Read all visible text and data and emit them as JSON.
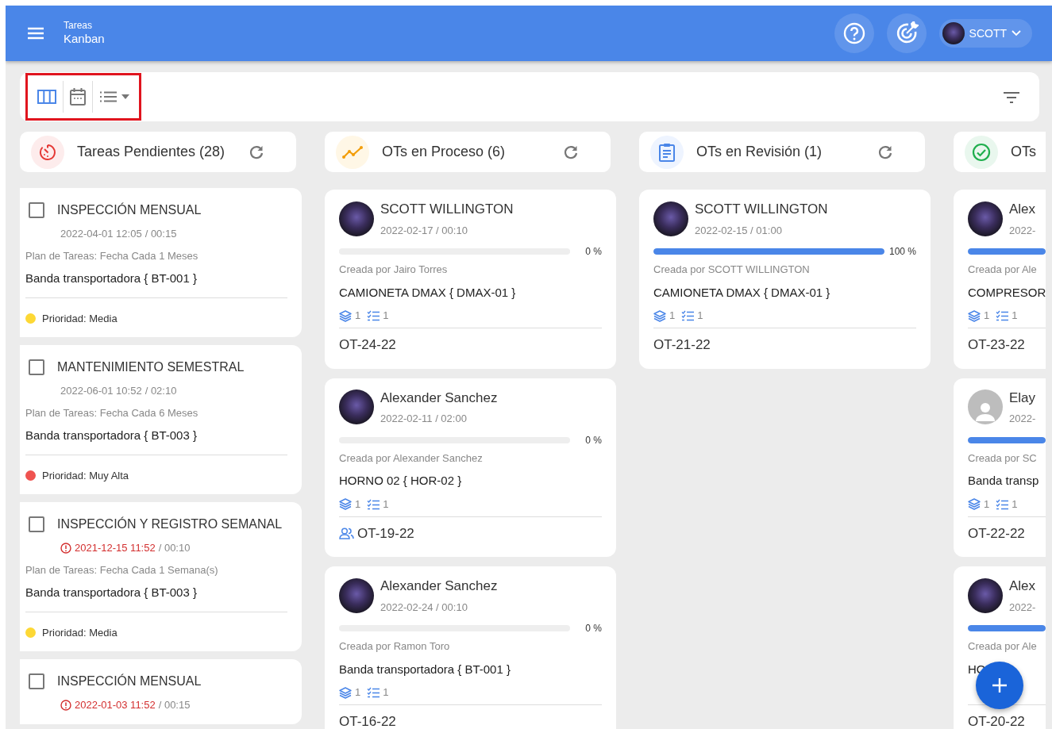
{
  "header": {
    "section": "Tareas",
    "title": "Kanban",
    "user": {
      "name": "SCOTT"
    }
  },
  "toolbar": {
    "highlighted": true,
    "views": [
      {
        "kind": "kanban",
        "selected": true
      },
      {
        "kind": "calendar",
        "selected": false
      },
      {
        "kind": "list",
        "selected": false
      }
    ]
  },
  "columns": [
    {
      "kind": "pending",
      "title": "Tareas Pendientes (28)",
      "cards": [
        {
          "checked": false,
          "title": "INSPECCIÓN MENSUAL",
          "date": "2022-04-01 12:05",
          "duration": "/ 00:15",
          "overdue": false,
          "plan": "Plan de Tareas: Fecha Cada 1 Meses",
          "asset": "Banda transportadora { BT-001 }",
          "priority": "Prioridad: Media",
          "color": "#fdd835"
        },
        {
          "checked": false,
          "title": "MANTENIMIENTO SEMESTRAL",
          "date": "2022-06-01 10:52",
          "duration": "/ 02:10",
          "overdue": false,
          "plan": "Plan de Tareas: Fecha Cada 6 Meses",
          "asset": "Banda transportadora { BT-003 }",
          "priority": "Prioridad: Muy Alta",
          "color": "#ef5350"
        },
        {
          "checked": false,
          "title": "INSPECCIÓN Y REGISTRO SEMANAL",
          "date": "2021-12-15 11:52",
          "duration": "/ 00:10",
          "overdue": true,
          "plan": "Plan de Tareas: Fecha Cada 1 Semana(s)",
          "asset": "Banda transportadora { BT-003 }",
          "priority": "Prioridad: Media",
          "color": "#fdd835"
        },
        {
          "checked": false,
          "title": "INSPECCIÓN MENSUAL",
          "date": "2022-01-03 11:52",
          "duration": "/ 00:15",
          "overdue": true
        }
      ]
    },
    {
      "kind": "process",
      "title": "OTs en Proceso (6)",
      "cards": [
        {
          "kind": "photo",
          "name": "SCOTT WILLINGTON",
          "date": "2022-02-17 / 00:10",
          "level": 0,
          "reading": "0 %",
          "creator": "Creada por Jairo Torres",
          "asset": "CAMIONETA DMAX { DMAX-01 }",
          "stack_count": "1",
          "task_count": "1",
          "team": false,
          "id": "OT-24-22"
        },
        {
          "kind": "photo",
          "name": "Alexander Sanchez",
          "date": "2022-02-11 / 02:00",
          "level": 0,
          "reading": "0 %",
          "creator": "Creada por Alexander Sanchez",
          "asset": "HORNO 02 { HOR-02 }",
          "stack_count": "1",
          "task_count": "1",
          "team": true,
          "id": "OT-19-22"
        },
        {
          "kind": "photo",
          "name": "Alexander Sanchez",
          "date": "2022-02-24 / 00:10",
          "level": 0,
          "reading": "0 %",
          "creator": "Creada por Ramon Toro",
          "asset": "Banda transportadora { BT-001 }",
          "stack_count": "1",
          "task_count": "1",
          "team": false,
          "id": "OT-16-22"
        }
      ]
    },
    {
      "kind": "review",
      "title": "OTs en Revisión (1)",
      "cards": [
        {
          "kind": "photo",
          "name": "SCOTT WILLINGTON",
          "date": "2022-02-15 / 01:00",
          "level": 1,
          "reading": "100 %",
          "creator": "Creada por SCOTT WILLINGTON",
          "asset": "CAMIONETA DMAX { DMAX-01 }",
          "stack_count": "1",
          "task_count": "1",
          "team": false,
          "id": "OT-21-22"
        }
      ]
    },
    {
      "kind": "done",
      "title": "OTs",
      "cards": [
        {
          "kind": "photo",
          "name": "Alex",
          "date": "2022-",
          "level": 1,
          "creator": "Creada por Ale",
          "asset": "COMPRESOR",
          "stack_count": "1",
          "task_count": "1",
          "team": false,
          "id": "OT-23-22"
        },
        {
          "kind": "placeholder",
          "name": "Elay",
          "date": "2022-",
          "level": 1,
          "creator": "Creada por SC",
          "asset": "Banda transp",
          "stack_count": "1",
          "task_count": "1",
          "team": false,
          "id": "OT-22-22"
        },
        {
          "kind": "photo",
          "name": "Alex",
          "date": "2022-",
          "level": 1,
          "creator": "Creada por Ale",
          "asset": "HO",
          "team": false,
          "id": "OT-20-22"
        }
      ]
    }
  ]
}
